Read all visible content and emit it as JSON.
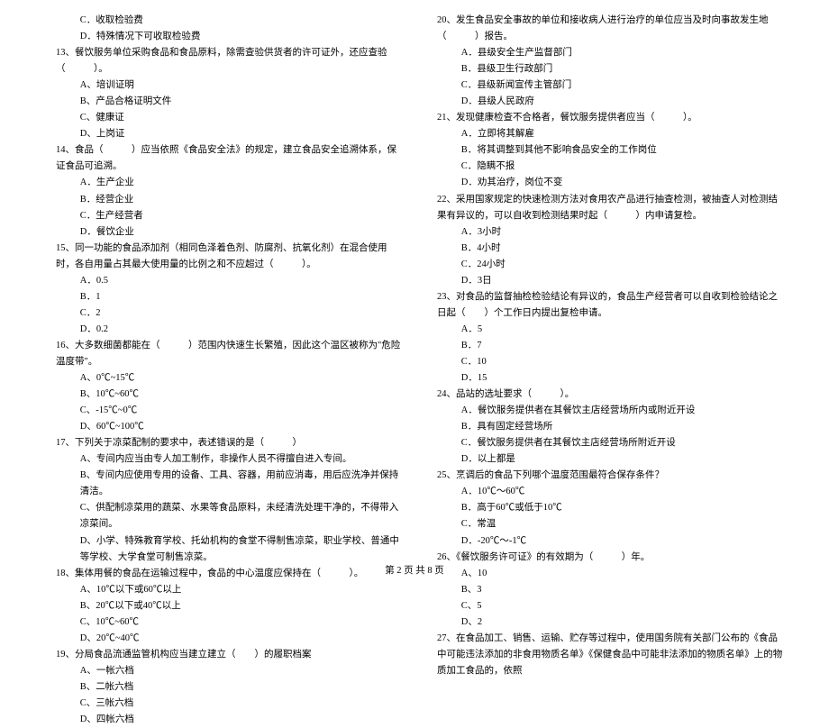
{
  "left": {
    "l01": "C．收取检验费",
    "l02": "D．特殊情况下可收取检验费",
    "q13": "13、餐饮服务单位采购食品和食品原料，除需查验供货者的许可证外，还应查验（　　　）。",
    "q13a": "A、培训证明",
    "q13b": "B、产品合格证明文件",
    "q13c": "C、健康证",
    "q13d": "D、上岗证",
    "q14": "14、食品（　　　）应当依照《食品安全法》的规定，建立食品安全追溯体系，保证食品可追溯。",
    "q14a": "A．生产企业",
    "q14b": "B．经营企业",
    "q14c": "C．生产经营者",
    "q14d": "D．餐饮企业",
    "q15": "15、同一功能的食品添加剂（相同色泽着色剂、防腐剂、抗氧化剂）在混合使用时，各自用量占其最大使用量的比例之和不应超过（　　　）。",
    "q15a": "A．0.5",
    "q15b": "B．1",
    "q15c": "C．2",
    "q15d": "D．0.2",
    "q16": "16、大多数细菌都能在（　　　）范围内快速生长繁殖，因此这个温区被称为\"危险温度带\"。",
    "q16a": "A、0℃~15℃",
    "q16b": "B、10℃~60℃",
    "q16c": "C、-15℃~0℃",
    "q16d": "D、60℃~100℃",
    "q17": "17、下列关于凉菜配制的要求中，表述错误的是（　　　）",
    "q17a": "A、专间内应当由专人加工制作，非操作人员不得擅自进入专间。",
    "q17b": "B、专间内应使用专用的设备、工具、容器，用前应消毒，用后应洗净并保持清洁。",
    "q17c": "C、供配制凉菜用的蔬菜、水果等食品原料，未经清洗处理干净的，不得带入凉菜间。",
    "q17d": "D、小学、特殊教育学校、托幼机构的食堂不得制售凉菜，职业学校、普通中等学校、大学食堂可制售凉菜。",
    "q18": "18、集体用餐的食品在运输过程中，食品的中心温度应保持在（　　　）。",
    "q18a": "A、10℃以下或60℃以上",
    "q18b": "B、20℃以下或40℃以上",
    "q18c": "C、10℃~60℃",
    "q18d": "D、20℃~40℃",
    "q19": "19、分局食品流通监管机构应当建立建立（　　）的履职档案",
    "q19a": "A、一帐六档",
    "q19b": "B、二帐六档",
    "q19c": "C、三帐六档",
    "q19d": "D、四帐六档"
  },
  "right": {
    "q20": "20、发生食品安全事故的单位和接收病人进行治疗的单位应当及时向事故发生地（　　　）报告。",
    "q20a": "A．县级安全生产监督部门",
    "q20b": "B．县级卫生行政部门",
    "q20c": "C．县级新闻宣传主管部门",
    "q20d": "D．县级人民政府",
    "q21": "21、发现健康检查不合格者，餐饮服务提供者应当（　　　）。",
    "q21a": "A．立即将其解雇",
    "q21b": "B．将其调整到其他不影响食品安全的工作岗位",
    "q21c": "C．隐瞒不报",
    "q21d": "D．劝其治疗，岗位不变",
    "q22": "22、采用国家规定的快速检测方法对食用农产品进行抽查检测，被抽查人对检测结果有异议的，可以自收到检测结果时起（　　　）内申请复检。",
    "q22a": "A．3小时",
    "q22b": "B．4小时",
    "q22c": "C．24小时",
    "q22d": "D．3日",
    "q23": "23、对食品的监督抽检检验结论有异议的，食品生产经营者可以自收到检验结论之日起（　　）个工作日内提出复检申请。",
    "q23a": "A．5",
    "q23b": "B．7",
    "q23c": "C．10",
    "q23d": "D．15",
    "q24": "24、品站的选址要求（　　　）。",
    "q24a": "A．餐饮服务提供者在其餐饮主店经营场所内或附近开设",
    "q24b": "B．具有固定经营场所",
    "q24c": "C．餐饮服务提供者在其餐饮主店经营场所附近开设",
    "q24d": "D．以上都是",
    "q25": "25、烹调后的食品下列哪个温度范围最符合保存条件？",
    "q25a": "A．10℃～60℃",
    "q25b": "B．高于60℃或低于10℃",
    "q25c": "C．常温",
    "q25d": "D．-20℃～-1℃",
    "q26": "26、《餐饮服务许可证》的有效期为（　　　）年。",
    "q26a": "A、10",
    "q26b": "B、3",
    "q26c": "C、5",
    "q26d": "D、2",
    "q27": "27、在食品加工、销售、运输、贮存等过程中，使用国务院有关部门公布的《食品中可能违法添加的非食用物质名单》《保健食品中可能非法添加的物质名单》上的物质加工食品的，依照"
  },
  "footer": "第 2 页 共 8 页"
}
